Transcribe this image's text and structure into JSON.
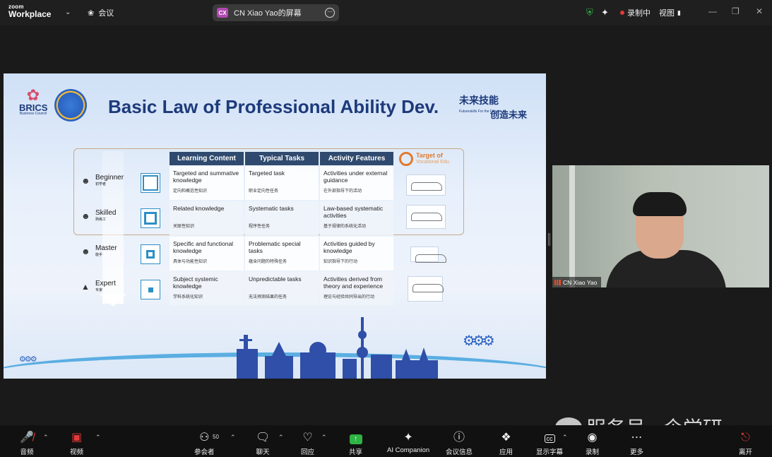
{
  "app": {
    "logo_line1": "zoom",
    "logo_line2": "Workplace"
  },
  "meeting": {
    "label": "会议"
  },
  "share_bar": {
    "initials": "CX",
    "title": "CN Xiao Yao的屏幕"
  },
  "top_right": {
    "recording": "录制中",
    "view": "视图"
  },
  "slide": {
    "title": "Basic Law of Professional Ability Dev.",
    "brics_name": "BRICS",
    "brics_sub": "Business Council",
    "futureskills_zh1": "未来技能",
    "futureskills_zh2": "创造未来",
    "futureskills_en": "Futureskills For the Future",
    "headers": [
      "Learning Content",
      "Typical Tasks",
      "Activity Features"
    ],
    "target_title": "Target of",
    "target_sub": "Vocational Edu.",
    "levels": [
      {
        "en": "Beginner",
        "zh": "初学者",
        "cells": [
          {
            "en": "Targeted and summative knowledge",
            "zh": "定向和概括性知识"
          },
          {
            "en": "Targeted task",
            "zh": "职业定向性任务"
          },
          {
            "en": "Activities under external guidance",
            "zh": "在外部指导下的活动"
          }
        ]
      },
      {
        "en": "Skilled",
        "zh": "熟练工",
        "cells": [
          {
            "en": "Related knowledge",
            "zh": "关联性知识"
          },
          {
            "en": "Systematic tasks",
            "zh": "程序性任务"
          },
          {
            "en": "Law-based systematic activities",
            "zh": "基于规律的系统化活动"
          }
        ]
      },
      {
        "en": "Master",
        "zh": "能手",
        "cells": [
          {
            "en": "Specific and functional knowledge",
            "zh": "具体与功能性知识"
          },
          {
            "en": "Problematic special tasks",
            "zh": "蕴含问题的特殊任务"
          },
          {
            "en": "Activities guided by knowledge",
            "zh": "知识指导下的行动"
          }
        ]
      },
      {
        "en": "Expert",
        "zh": "专家",
        "cells": [
          {
            "en": "Subject systemic knowledge",
            "zh": "学科系统化知识"
          },
          {
            "en": "Unpredictable tasks",
            "zh": "无法预测结果的任务"
          },
          {
            "en": "Activities derived from theory and experience",
            "zh": "理论与经验共同导出的行动"
          }
        ]
      }
    ]
  },
  "video": {
    "participant": "CN Xiao Yao"
  },
  "watermark": {
    "text": "服务号 · 企学研"
  },
  "toolbar": {
    "audio": "音频",
    "video": "视频",
    "participants": "参会者",
    "participants_count": "50",
    "chat": "聊天",
    "react": "回应",
    "share": "共享",
    "ai": "AI Companion",
    "info": "会议信息",
    "apps": "应用",
    "captions": "显示字幕",
    "record": "录制",
    "more": "更多",
    "leave": "离开"
  },
  "colors": {
    "accent_green": "#2fb344",
    "record_red": "#e03a3a",
    "slide_title": "#1d3a7a",
    "table_header": "#2f4a6e"
  }
}
